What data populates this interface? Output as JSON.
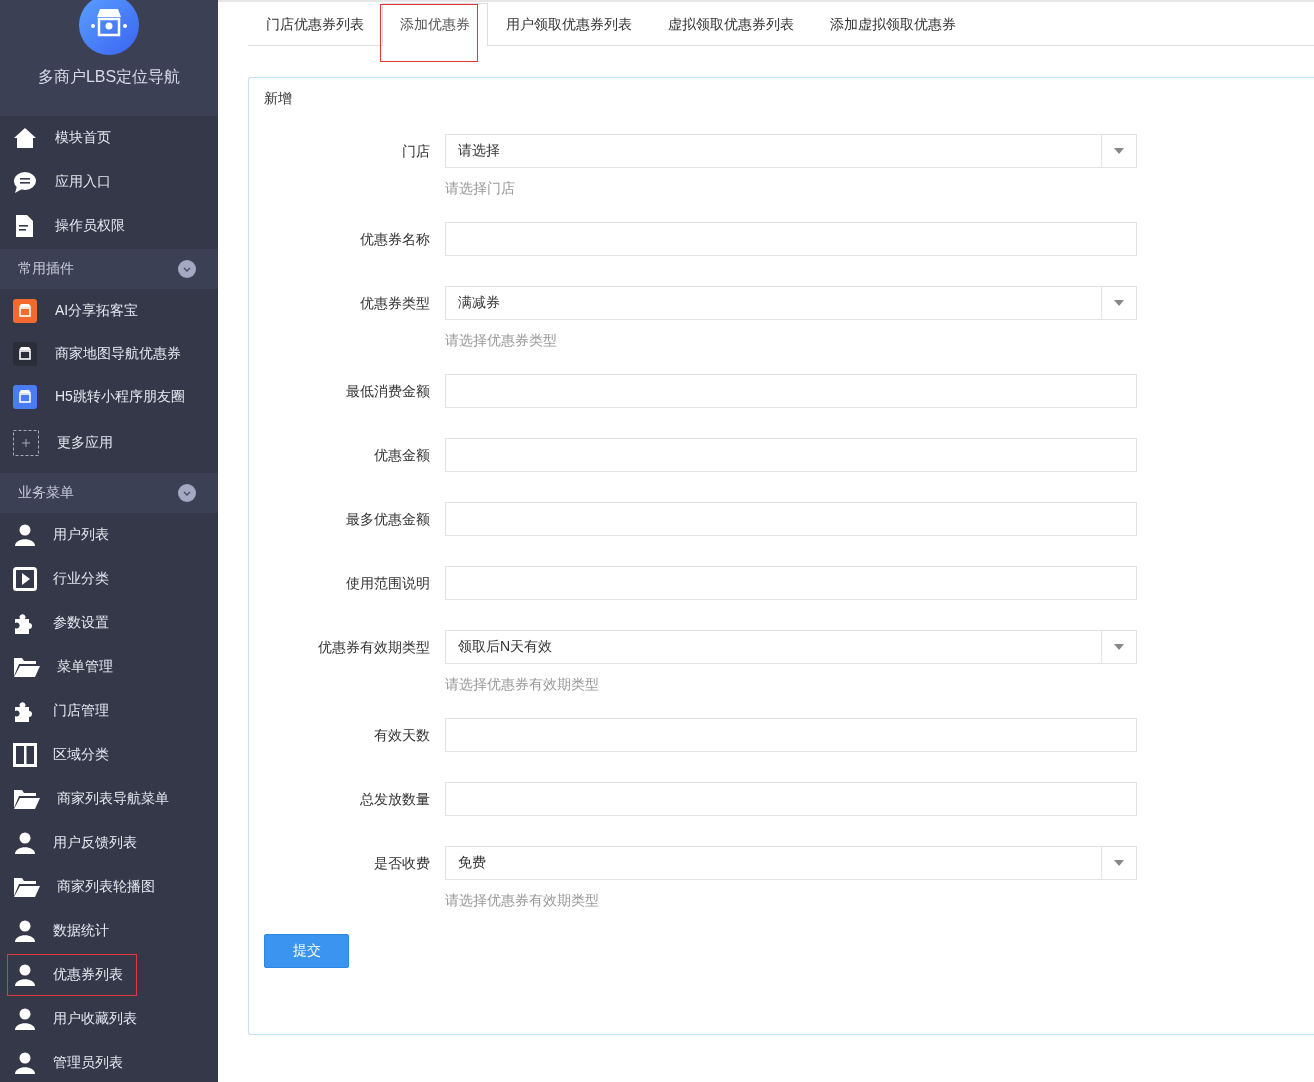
{
  "sidebar": {
    "title": "多商户LBS定位导航",
    "items": [
      {
        "label": "模块首页",
        "kind": "home"
      },
      {
        "label": "应用入口",
        "kind": "chat"
      },
      {
        "label": "操作员权限",
        "kind": "doc"
      }
    ],
    "sections": [
      {
        "title": "常用插件",
        "expanded": true,
        "items": [
          {
            "label": "AI分享拓客宝",
            "kind": "app",
            "color": "#f26a2e",
            "highlighted": false
          },
          {
            "label": "商家地图导航优惠券",
            "kind": "app",
            "color": "#2b2d38",
            "highlighted": false
          },
          {
            "label": "H5跳转小程序朋友圈",
            "kind": "app",
            "color": "#4a7cf5",
            "highlighted": false
          },
          {
            "label": "更多应用",
            "kind": "more",
            "highlighted": false
          }
        ]
      },
      {
        "title": "业务菜单",
        "expanded": true,
        "items": [
          {
            "label": "用户列表",
            "kind": "user",
            "highlighted": false
          },
          {
            "label": "行业分类",
            "kind": "play",
            "highlighted": false
          },
          {
            "label": "参数设置",
            "kind": "puzzle",
            "highlighted": false
          },
          {
            "label": "菜单管理",
            "kind": "folder",
            "highlighted": false
          },
          {
            "label": "门店管理",
            "kind": "puzzle",
            "highlighted": false
          },
          {
            "label": "区域分类",
            "kind": "columns",
            "highlighted": false
          },
          {
            "label": "商家列表导航菜单",
            "kind": "folder",
            "highlighted": false
          },
          {
            "label": "用户反馈列表",
            "kind": "user",
            "highlighted": false
          },
          {
            "label": "商家列表轮播图",
            "kind": "folder",
            "highlighted": false
          },
          {
            "label": "数据统计",
            "kind": "user",
            "highlighted": false
          },
          {
            "label": "优惠券列表",
            "kind": "user",
            "highlighted": true
          },
          {
            "label": "用户收藏列表",
            "kind": "user",
            "highlighted": false
          },
          {
            "label": "管理员列表",
            "kind": "user",
            "highlighted": false
          }
        ]
      }
    ]
  },
  "tabs": [
    {
      "label": "门店优惠券列表",
      "selected": false,
      "highlighted": false
    },
    {
      "label": "添加优惠券",
      "selected": true,
      "highlighted": true
    },
    {
      "label": "用户领取优惠券列表",
      "selected": false,
      "highlighted": false
    },
    {
      "label": "虚拟领取优惠券列表",
      "selected": false,
      "highlighted": false
    },
    {
      "label": "添加虚拟领取优惠券",
      "selected": false,
      "highlighted": false
    }
  ],
  "form": {
    "title": "新增",
    "fields": [
      {
        "label": "门店",
        "kind": "select",
        "value": "请选择",
        "help": "请选择门店"
      },
      {
        "label": "优惠券名称",
        "kind": "text"
      },
      {
        "label": "优惠券类型",
        "kind": "select",
        "value": "满减券",
        "help": "请选择优惠券类型"
      },
      {
        "label": "最低消费金额",
        "kind": "text"
      },
      {
        "label": "优惠金额",
        "kind": "text"
      },
      {
        "label": "最多优惠金额",
        "kind": "text"
      },
      {
        "label": "使用范围说明",
        "kind": "text"
      },
      {
        "label": "优惠券有效期类型",
        "kind": "select",
        "value": "领取后N天有效",
        "help": "请选择优惠券有效期类型"
      },
      {
        "label": "有效天数",
        "kind": "text"
      },
      {
        "label": "总发放数量",
        "kind": "text"
      },
      {
        "label": "是否收费",
        "kind": "select",
        "value": "免费",
        "help": "请选择优惠券有效期类型"
      }
    ],
    "submit": "提交"
  }
}
